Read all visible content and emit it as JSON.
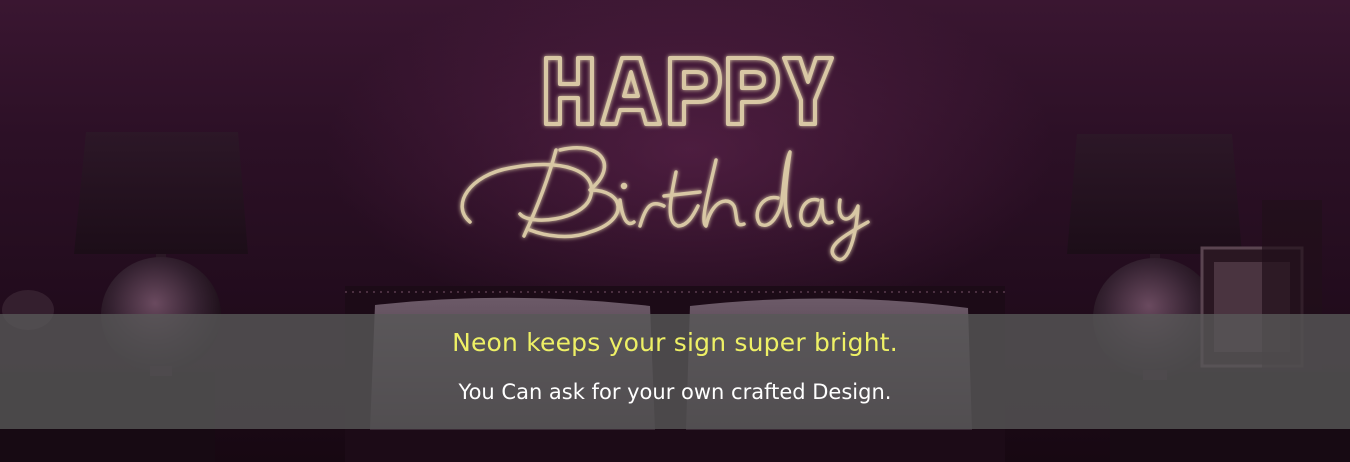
{
  "banner": {
    "neon_sign": {
      "line1": "HAPPY",
      "line2": "Birthday"
    },
    "headline": "Neon keeps your sign super bright.",
    "subline": "You Can ask for your own crafted Design."
  },
  "colors": {
    "wall": "#2c1026",
    "neon": "#d8c7a4",
    "headline": "#eef065",
    "subline": "#ffffff",
    "caption_band": "#585858"
  }
}
